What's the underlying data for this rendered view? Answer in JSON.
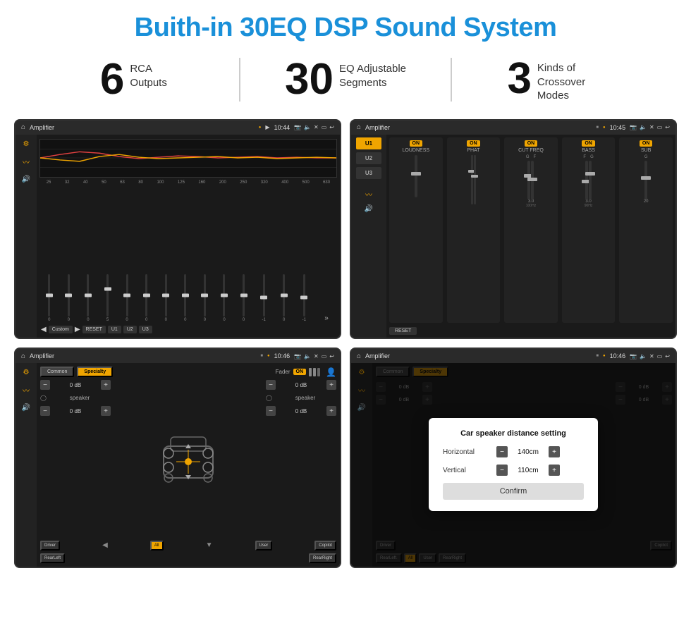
{
  "page": {
    "title": "Buith-in 30EQ DSP Sound System"
  },
  "stats": [
    {
      "number": "6",
      "label": "RCA\nOutputs"
    },
    {
      "number": "30",
      "label": "EQ Adjustable\nSegments"
    },
    {
      "number": "3",
      "label": "Kinds of\nCrossover Modes"
    }
  ],
  "screens": [
    {
      "id": "screen-eq",
      "topbar": {
        "title": "Amplifier",
        "time": "10:44"
      },
      "eq_frequencies": [
        "25",
        "32",
        "40",
        "50",
        "63",
        "80",
        "100",
        "125",
        "160",
        "200",
        "250",
        "320",
        "400",
        "500",
        "630"
      ],
      "eq_values": [
        "0",
        "0",
        "0",
        "5",
        "0",
        "0",
        "0",
        "0",
        "0",
        "0",
        "0",
        "-1",
        "0",
        "-1"
      ],
      "eq_presets": [
        "Custom",
        "RESET",
        "U1",
        "U2",
        "U3"
      ]
    },
    {
      "id": "screen-amp",
      "topbar": {
        "title": "Amplifier",
        "time": "10:45"
      },
      "presets": [
        "U1",
        "U2",
        "U3"
      ],
      "controls": [
        "LOUDNESS",
        "PHAT",
        "CUT FREQ",
        "BASS",
        "SUB"
      ],
      "reset_label": "RESET"
    },
    {
      "id": "screen-cross",
      "topbar": {
        "title": "Amplifier",
        "time": "10:46"
      },
      "tabs": [
        "Common",
        "Specialty"
      ],
      "fader_label": "Fader",
      "controls": {
        "left_db1": "0 dB",
        "left_db2": "0 dB",
        "right_db1": "0 dB",
        "right_db2": "0 dB"
      },
      "bottom_buttons": [
        "Driver",
        "",
        "Copilot",
        "RearLeft",
        "All",
        "User",
        "RearRight"
      ]
    },
    {
      "id": "screen-dialog",
      "topbar": {
        "title": "Amplifier",
        "time": "10:46"
      },
      "dialog": {
        "title": "Car speaker distance setting",
        "horizontal_label": "Horizontal",
        "horizontal_value": "140cm",
        "vertical_label": "Vertical",
        "vertical_value": "110cm",
        "confirm_label": "Confirm"
      },
      "bottom_buttons": [
        "Driver",
        "Copilot",
        "RearLeft.",
        "User",
        "RearRight"
      ]
    }
  ],
  "colors": {
    "brand_blue": "#1a90d9",
    "gold": "#f0a500",
    "dark_bg": "#1a1a1a",
    "text_light": "#cccccc"
  }
}
